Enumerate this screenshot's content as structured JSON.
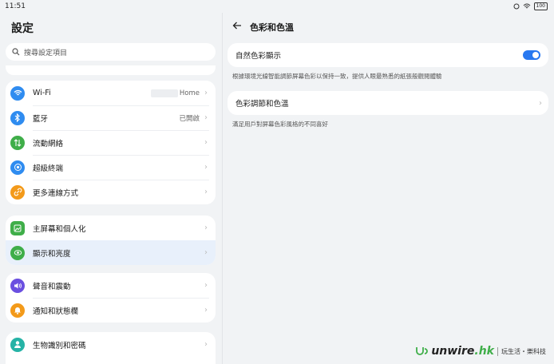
{
  "status": {
    "time": "11:51",
    "battery": "100"
  },
  "left": {
    "title": "設定",
    "search_placeholder": "搜尋設定項目",
    "groups": [
      {
        "items": [
          {
            "label": "Wi-Fi",
            "value": "Home",
            "icon": "wifi-icon",
            "color": "#2f8cf0"
          },
          {
            "label": "藍牙",
            "value": "已開啟",
            "icon": "bluetooth-icon",
            "color": "#2f8cf0"
          },
          {
            "label": "流動網絡",
            "value": "",
            "icon": "mobile-data-icon",
            "color": "#3fae49"
          },
          {
            "label": "超級終端",
            "value": "",
            "icon": "super-device-icon",
            "color": "#2f8cf0"
          },
          {
            "label": "更多連線方式",
            "value": "",
            "icon": "more-connections-icon",
            "color": "#f39a1a"
          }
        ]
      },
      {
        "items": [
          {
            "label": "主屏幕和個人化",
            "value": "",
            "icon": "home-screen-icon",
            "color": "#3fae49"
          },
          {
            "label": "顯示和亮度",
            "value": "",
            "icon": "display-brightness-icon",
            "color": "#3fae49"
          }
        ]
      },
      {
        "items": [
          {
            "label": "聲音和震動",
            "value": "",
            "icon": "sound-icon",
            "color": "#6a4fe0"
          },
          {
            "label": "通知和狀態欄",
            "value": "",
            "icon": "notification-icon",
            "color": "#f39a1a"
          }
        ]
      },
      {
        "items": [
          {
            "label": "生物識別和密碼",
            "value": "",
            "icon": "biometrics-icon",
            "color": "#26b3a6"
          }
        ]
      }
    ]
  },
  "right": {
    "title": "色彩和色溫",
    "natural_color": {
      "label": "自然色彩顯示",
      "enabled": true,
      "desc": "根據環境光線智能調節屏幕色彩以保持一致，提供人眼最熟悉的紙張般觀閱體驗"
    },
    "color_adjust": {
      "label": "色彩調節和色溫",
      "desc": "滿足用戶對屏幕色彩風格的不同喜好"
    }
  },
  "watermark": {
    "brand_prefix": "unwire",
    "brand_suffix": ".hk",
    "tagline": "玩生活・樂科技"
  },
  "colors": {
    "accent": "#2878f0",
    "selected_row": "#e8f0fb"
  }
}
